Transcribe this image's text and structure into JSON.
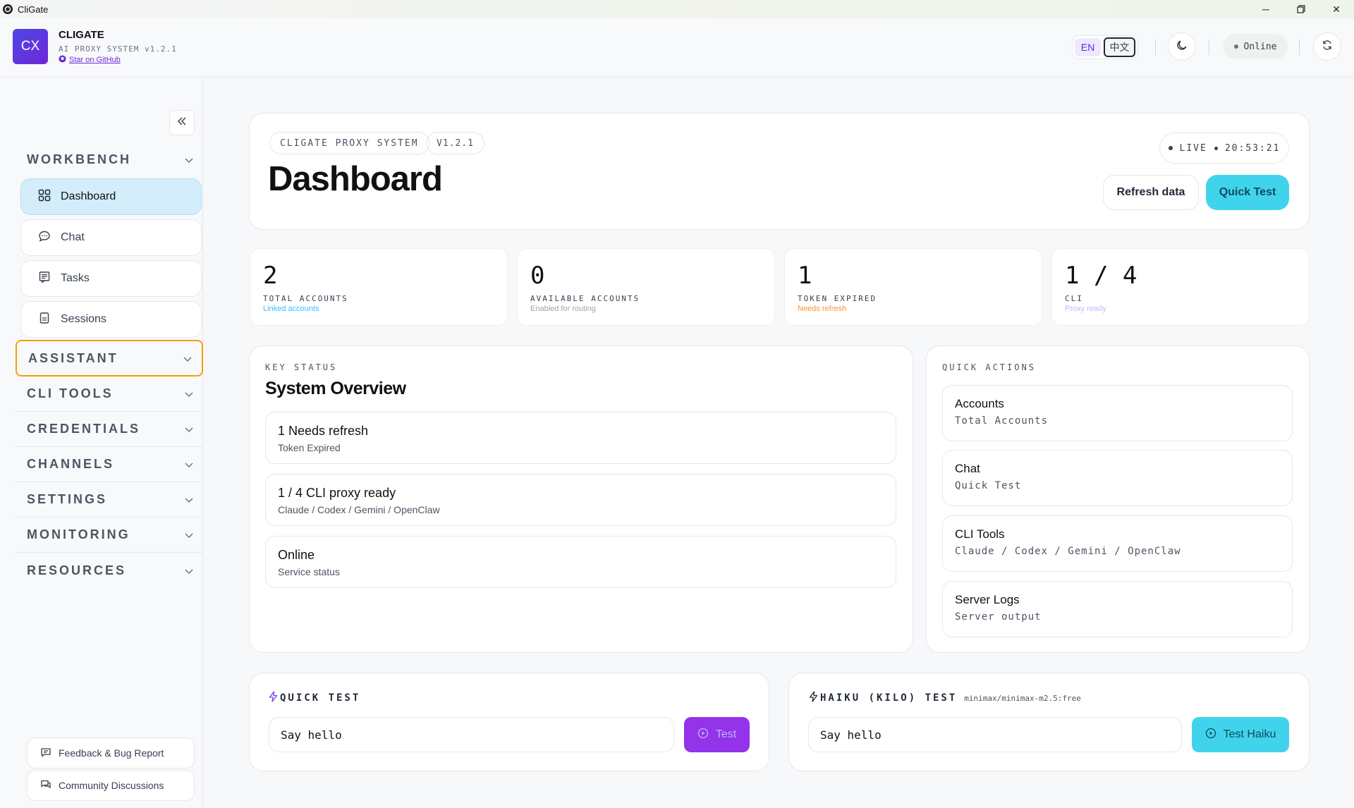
{
  "window": {
    "title": "CliGate"
  },
  "header": {
    "logo_text": "CX",
    "brand": "CLIGATE",
    "subtitle": "AI PROXY SYSTEM v1.2.1",
    "github_link": "Star on GitHub",
    "lang_en": "EN",
    "lang_zh": "中文",
    "status": "Online"
  },
  "sidebar": {
    "sections": [
      {
        "label": "WORKBENCH"
      },
      {
        "label": "ASSISTANT"
      },
      {
        "label": "CLI TOOLS"
      },
      {
        "label": "CREDENTIALS"
      },
      {
        "label": "CHANNELS"
      },
      {
        "label": "SETTINGS"
      },
      {
        "label": "MONITORING"
      },
      {
        "label": "RESOURCES"
      }
    ],
    "items": [
      {
        "label": "Dashboard",
        "icon": "grid-icon"
      },
      {
        "label": "Chat",
        "icon": "chat-bubble-icon"
      },
      {
        "label": "Tasks",
        "icon": "tasks-icon"
      },
      {
        "label": "Sessions",
        "icon": "sessions-icon"
      }
    ],
    "footer": {
      "feedback": "Feedback & Bug Report",
      "community": "Community Discussions"
    }
  },
  "hero": {
    "chip_system": "CLIGATE PROXY SYSTEM",
    "chip_version": "V1.2.1",
    "title": "Dashboard",
    "live_label": "LIVE",
    "live_time": "20:53:21",
    "refresh_button": "Refresh data",
    "quick_test_button": "Quick Test"
  },
  "stats": [
    {
      "value": "2",
      "label": "TOTAL ACCOUNTS",
      "sub": "Linked accounts",
      "sub_color": "#38bdf8"
    },
    {
      "value": "0",
      "label": "AVAILABLE ACCOUNTS",
      "sub": "Enabled for routing",
      "sub_color": "#9ca3af"
    },
    {
      "value": "1",
      "label": "TOKEN EXPIRED",
      "sub": "Needs refresh",
      "sub_color": "#fb923c"
    },
    {
      "value": "1 / 4",
      "label": "CLI",
      "sub": "Proxy ready",
      "sub_color": "#c4b5fd"
    }
  ],
  "overview": {
    "kicker": "KEY STATUS",
    "title": "System Overview",
    "rows": [
      {
        "title": "1 Needs refresh",
        "sub": "Token Expired"
      },
      {
        "title": "1 / 4 CLI proxy ready",
        "sub": "Claude / Codex / Gemini / OpenClaw"
      },
      {
        "title": "Online",
        "sub": "Service status"
      }
    ]
  },
  "quick_actions": {
    "kicker": "QUICK ACTIONS",
    "items": [
      {
        "title": "Accounts",
        "sub": "Total Accounts"
      },
      {
        "title": "Chat",
        "sub": "Quick Test"
      },
      {
        "title": "CLI Tools",
        "sub": "Claude / Codex / Gemini / OpenClaw"
      },
      {
        "title": "Server Logs",
        "sub": "Server output"
      }
    ]
  },
  "quick_test": {
    "label": "QUICK TEST",
    "input": "Say hello",
    "button": "Test"
  },
  "haiku_test": {
    "label": "HAIKU (KILO) TEST",
    "model": "minimax/minimax-m2.5:free",
    "input": "Say hello",
    "button": "Test Haiku"
  },
  "colors": {
    "accent_cyan": "#40d4ec",
    "accent_purple": "#9333ea",
    "active_nav": "#d3edfb",
    "section_focus": "#f59e0b"
  }
}
